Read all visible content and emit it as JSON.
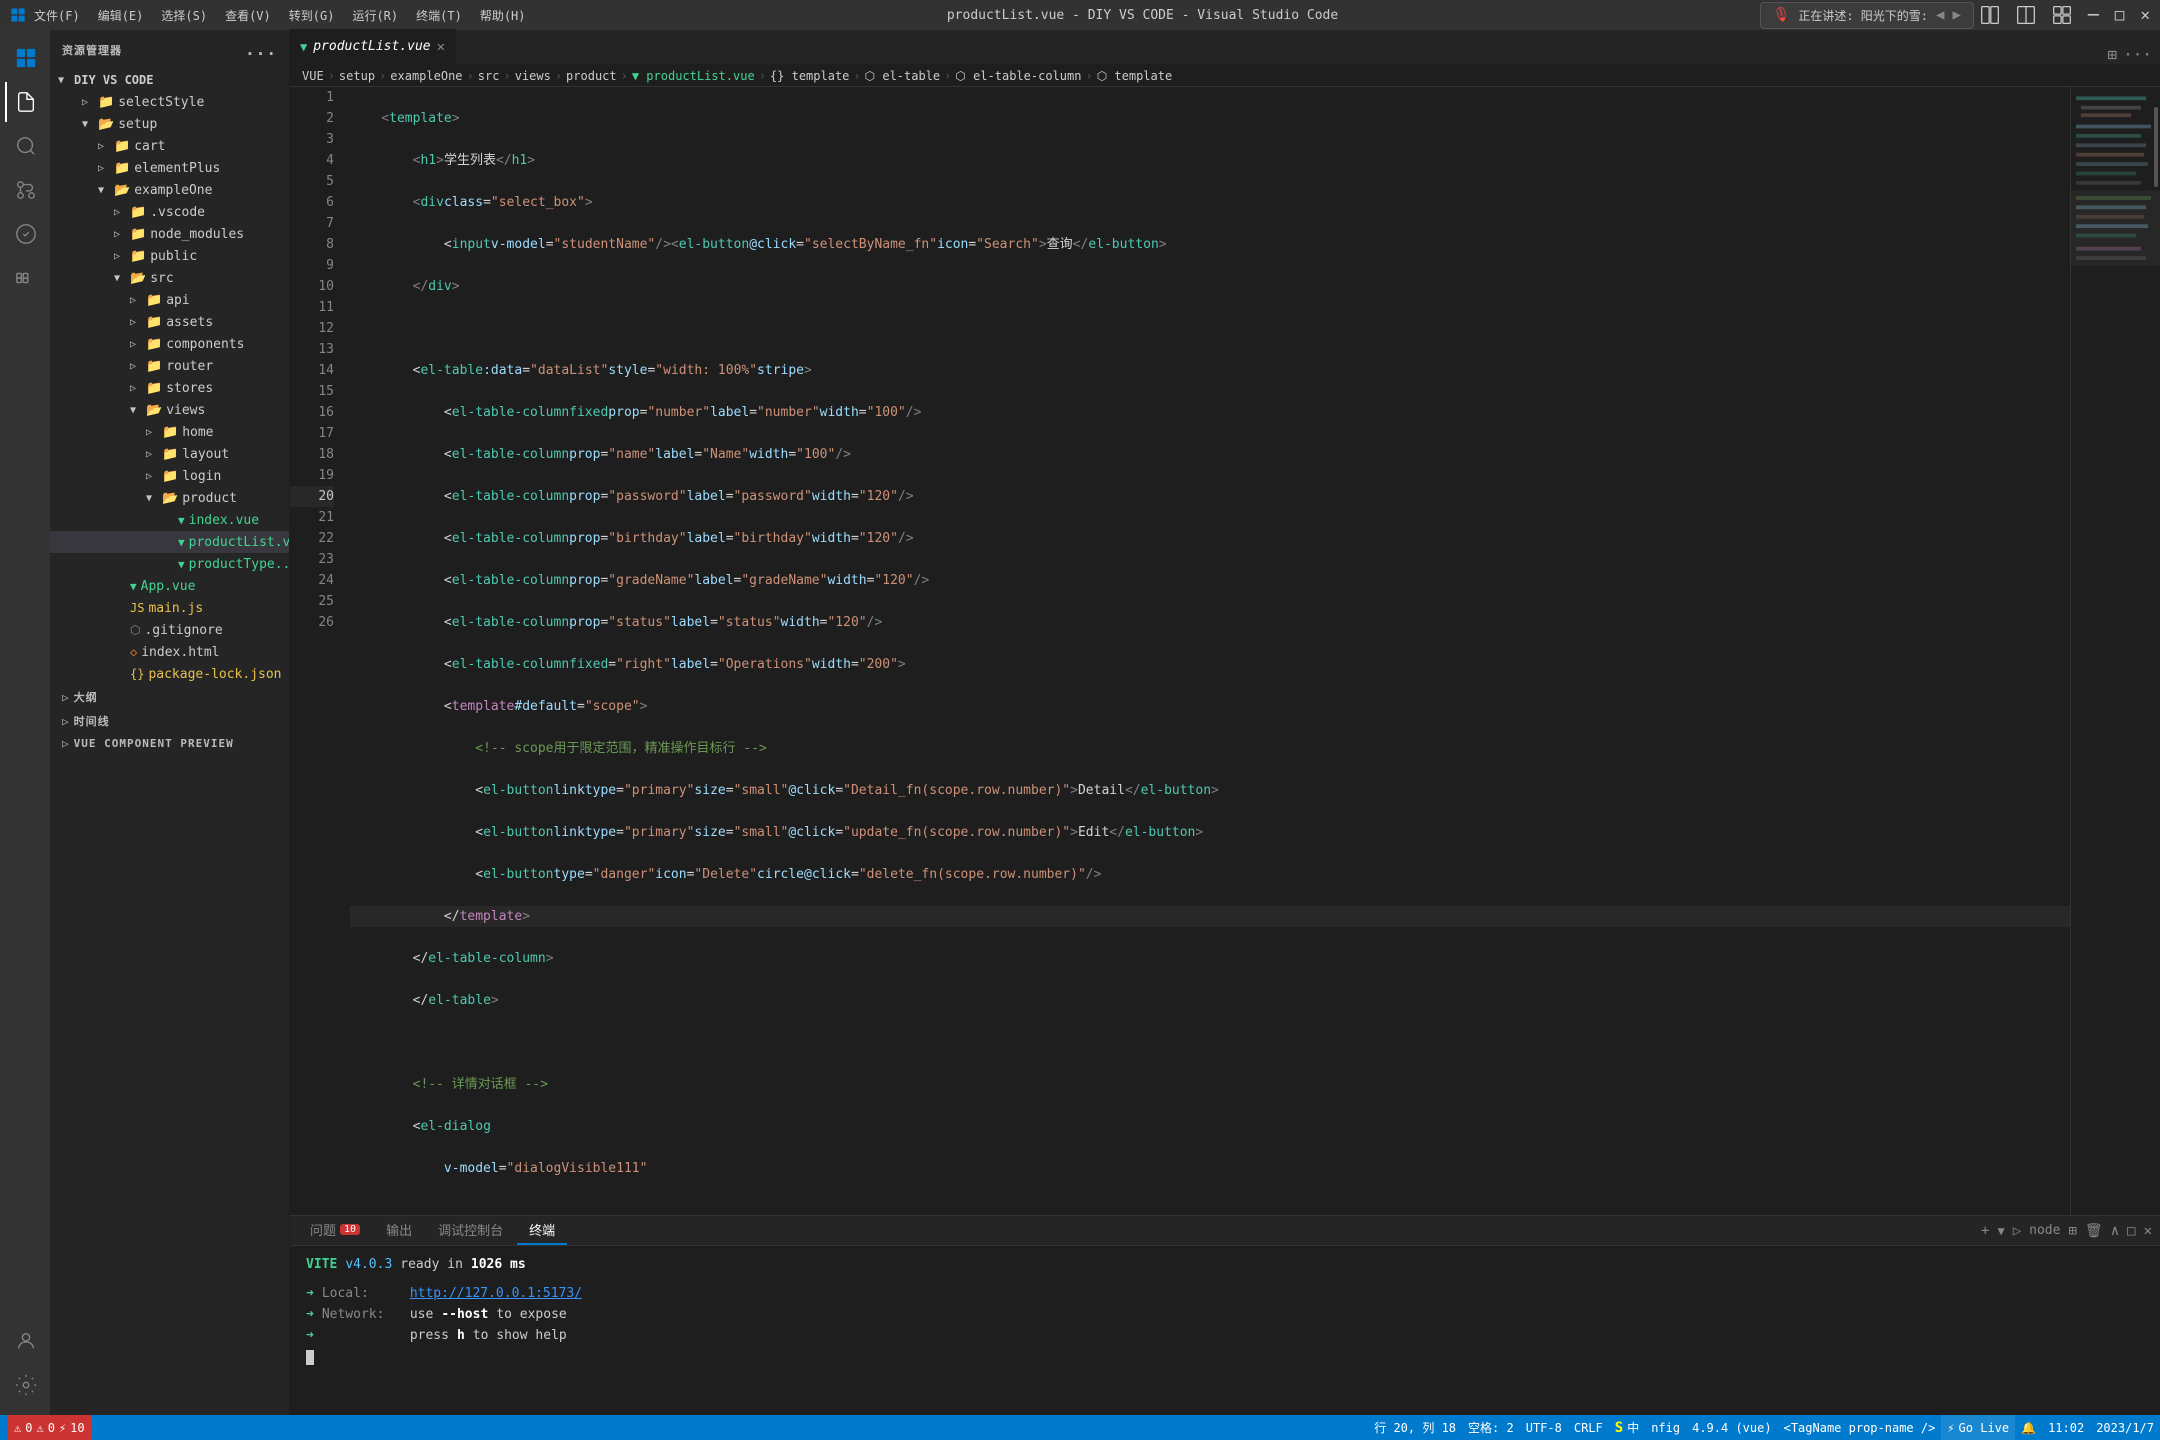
{
  "titlebar": {
    "menus": [
      "文件(F)",
      "编辑(E)",
      "选择(S)",
      "查看(V)",
      "转到(G)",
      "运行(R)",
      "终端(T)",
      "帮助(H)"
    ],
    "center": "productList.vue - DIY VS CODE - Visual Studio Code",
    "controls": [
      "─",
      "□",
      "✕"
    ]
  },
  "notification": {
    "icon": "🎙",
    "text": "正在讲述: 阳光下的雪:",
    "arrow_left": "◀",
    "arrow_right": "▶"
  },
  "sidebar": {
    "header": "资源管理器",
    "more_icon": "...",
    "project": "DIY VS CODE",
    "tree": [
      {
        "indent": 1,
        "type": "folder",
        "expanded": true,
        "label": "selectStyle",
        "depth": 1
      },
      {
        "indent": 2,
        "type": "folder",
        "expanded": true,
        "label": "setup",
        "depth": 1
      },
      {
        "indent": 3,
        "type": "folder",
        "expanded": false,
        "label": "cart",
        "depth": 2
      },
      {
        "indent": 3,
        "type": "folder",
        "expanded": false,
        "label": "elementPlus",
        "depth": 2
      },
      {
        "indent": 3,
        "type": "folder",
        "expanded": true,
        "label": "exampleOne",
        "depth": 2
      },
      {
        "indent": 4,
        "type": "folder",
        "expanded": false,
        "label": ".vscode",
        "depth": 3
      },
      {
        "indent": 4,
        "type": "folder",
        "expanded": false,
        "label": "node_modules",
        "depth": 3
      },
      {
        "indent": 4,
        "type": "folder",
        "expanded": false,
        "label": "public",
        "depth": 3
      },
      {
        "indent": 4,
        "type": "folder",
        "expanded": true,
        "label": "src",
        "depth": 3
      },
      {
        "indent": 5,
        "type": "folder",
        "expanded": false,
        "label": "api",
        "depth": 4
      },
      {
        "indent": 5,
        "type": "folder",
        "expanded": false,
        "label": "assets",
        "depth": 4
      },
      {
        "indent": 5,
        "type": "folder",
        "expanded": false,
        "label": "components",
        "depth": 4
      },
      {
        "indent": 5,
        "type": "folder",
        "expanded": false,
        "label": "router",
        "depth": 4
      },
      {
        "indent": 5,
        "type": "folder",
        "expanded": false,
        "label": "stores",
        "depth": 4
      },
      {
        "indent": 5,
        "type": "folder",
        "expanded": true,
        "label": "views",
        "depth": 4
      },
      {
        "indent": 6,
        "type": "folder",
        "expanded": false,
        "label": "home",
        "depth": 5
      },
      {
        "indent": 6,
        "type": "folder",
        "expanded": false,
        "label": "layout",
        "depth": 5
      },
      {
        "indent": 6,
        "type": "folder",
        "expanded": false,
        "label": "login",
        "depth": 5
      },
      {
        "indent": 6,
        "type": "folder",
        "expanded": true,
        "label": "product",
        "depth": 5
      },
      {
        "indent": 7,
        "type": "vue",
        "label": "index.vue",
        "depth": 6
      },
      {
        "indent": 7,
        "type": "vue",
        "label": "productList.vue",
        "selected": true,
        "depth": 6
      },
      {
        "indent": 7,
        "type": "vue",
        "label": "productType...",
        "depth": 6
      }
    ],
    "root_files": [
      {
        "type": "vue",
        "label": "App.vue"
      },
      {
        "type": "js",
        "label": "main.js"
      },
      {
        "type": "dotfile",
        "label": ".gitignore"
      },
      {
        "type": "html",
        "label": "index.html"
      },
      {
        "type": "json",
        "label": "package-lock.json"
      }
    ],
    "sections": [
      {
        "label": "大纲"
      },
      {
        "label": "时间线"
      },
      {
        "label": "VUE COMPONENT PREVIEW"
      }
    ]
  },
  "tabs": [
    {
      "name": "productList.vue",
      "active": true,
      "modified": true,
      "icon": "vue"
    }
  ],
  "breadcrumb": {
    "items": [
      "VUE",
      "setup",
      "exampleOne",
      "src",
      "views",
      "product",
      "productList.vue",
      "{} template",
      "el-table",
      "el-table-column",
      "template"
    ]
  },
  "code": {
    "lines": [
      {
        "num": 1,
        "content": "    <template>"
      },
      {
        "num": 2,
        "content": "        <h1>学生列表</h1>"
      },
      {
        "num": 3,
        "content": "        <div class=\"select_box\">"
      },
      {
        "num": 4,
        "content": "            <input v-model=\"studentName\"/><el-button @click=\"selectByName_fn\" icon=\"Search\">查询</el-button>"
      },
      {
        "num": 5,
        "content": "        </div>"
      },
      {
        "num": 6,
        "content": ""
      },
      {
        "num": 7,
        "content": "        <el-table :data=\"dataList\" style=\"width: 100%\" stripe>"
      },
      {
        "num": 8,
        "content": "            <el-table-column fixed prop=\"number\" label=\"number\" width=\"100\" />"
      },
      {
        "num": 9,
        "content": "            <el-table-column prop=\"name\" label=\"Name\" width=\"100\" />"
      },
      {
        "num": 10,
        "content": "            <el-table-column prop=\"password\" label=\"password\" width=\"120\" />"
      },
      {
        "num": 11,
        "content": "            <el-table-column prop=\"birthday\" label=\"birthday\" width=\"120\" />"
      },
      {
        "num": 12,
        "content": "            <el-table-column prop=\"gradeName\" label=\"gradeName\" width=\"120\" />"
      },
      {
        "num": 13,
        "content": "            <el-table-column prop=\"status\" label=\"status\" width=\"120\" />"
      },
      {
        "num": 14,
        "content": "            <el-table-column fixed=\"right\" label=\"Operations\" width=\"200\">"
      },
      {
        "num": 15,
        "content": "            <template #default=\"scope\">"
      },
      {
        "num": 16,
        "content": "                <!-- scope用于限定范围，精准操作目标行 -->"
      },
      {
        "num": 17,
        "content": "                <el-button link type=\"primary\" size=\"small\" @click=\"Detail_fn(scope.row.number)\">Detail</el-button>"
      },
      {
        "num": 18,
        "content": "                <el-button link type=\"primary\" size=\"small\" @click=\"update_fn(scope.row.number)\">Edit</el-button>"
      },
      {
        "num": 19,
        "content": "                <el-button type=\"danger\" icon=\"Delete\" circle  @click=\"delete_fn(scope.row.number)\"/>"
      },
      {
        "num": 20,
        "content": "            </template>"
      },
      {
        "num": 21,
        "content": "        </el-table-column>"
      },
      {
        "num": 22,
        "content": "        </el-table>"
      },
      {
        "num": 23,
        "content": ""
      },
      {
        "num": 24,
        "content": "        <!-- 详情对话框 -->"
      },
      {
        "num": 25,
        "content": "        <el-dialog"
      },
      {
        "num": 26,
        "content": "            v-model=\"dialogVisible111\""
      }
    ],
    "active_line": 20
  },
  "panel": {
    "tabs": [
      {
        "label": "问题",
        "badge": "10"
      },
      {
        "label": "输出"
      },
      {
        "label": "调试控制台"
      },
      {
        "label": "终端",
        "active": true
      }
    ],
    "terminal": {
      "title": "node",
      "vite": {
        "label": "VITE",
        "version": "v4.0.3",
        "ready": "ready in",
        "time": "1026 ms"
      },
      "local": {
        "label": "Local:",
        "url": "http://127.0.0.1:5173/"
      },
      "network": {
        "label": "Network:",
        "text": "use --host to expose"
      },
      "press": {
        "text1": "press",
        "key": "h",
        "text2": "to show help"
      }
    }
  },
  "statusbar": {
    "left": [
      {
        "icon": "git",
        "text": "⓪ 0"
      },
      {
        "icon": "error",
        "text": "⚠ 0"
      },
      {
        "icon": "warning",
        "text": "⚡ 10"
      }
    ],
    "right": [
      {
        "text": "行 20, 列 18"
      },
      {
        "text": "空格: 2"
      },
      {
        "text": "UTF-8"
      },
      {
        "text": "CRLF"
      },
      {
        "icon": "lang",
        "text": "S 中"
      },
      {
        "text": "nfig"
      },
      {
        "text": "4.9.4 (vue)"
      },
      {
        "text": "<TagName prop-name />"
      },
      {
        "text": "⚡ Go Live"
      },
      {
        "text": "🔔"
      }
    ],
    "time": "11:02",
    "date": "2023/1/7"
  }
}
